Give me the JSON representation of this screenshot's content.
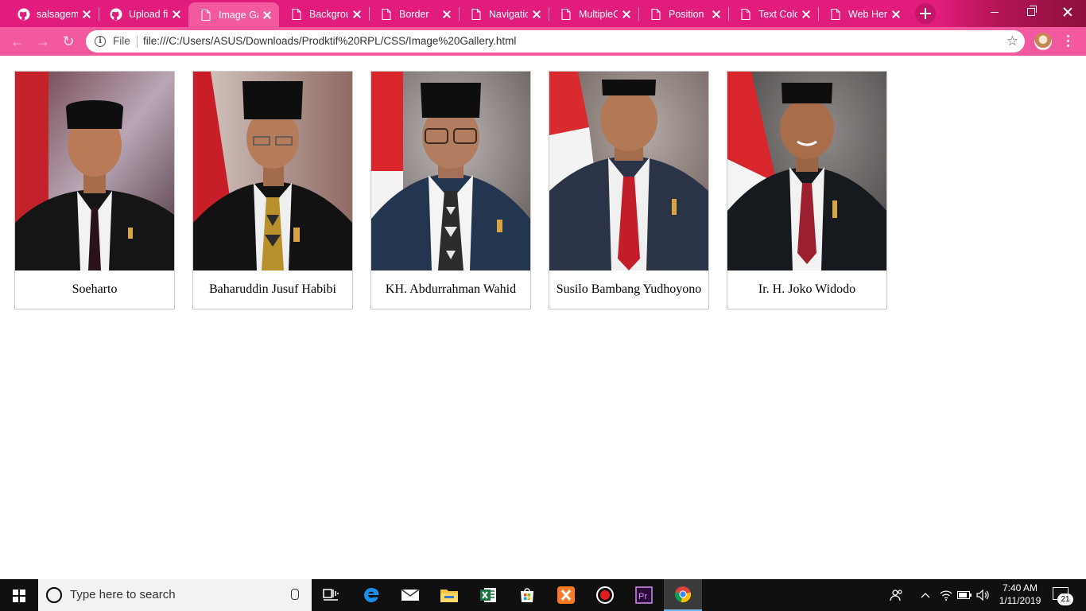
{
  "browser": {
    "tabs": [
      {
        "title": "salsagem",
        "icon": "github-icon",
        "active": false
      },
      {
        "title": "Upload fi",
        "icon": "github-icon",
        "active": false
      },
      {
        "title": "Image Ga",
        "icon": "page-icon",
        "active": true
      },
      {
        "title": "Backgrou",
        "icon": "page-icon",
        "active": false
      },
      {
        "title": "Border",
        "icon": "page-icon",
        "active": false
      },
      {
        "title": "Navigatic",
        "icon": "page-icon",
        "active": false
      },
      {
        "title": "MultipleC",
        "icon": "page-icon",
        "active": false
      },
      {
        "title": "Position I",
        "icon": "page-icon",
        "active": false
      },
      {
        "title": "Text Colo",
        "icon": "page-icon",
        "active": false
      },
      {
        "title": "Web Her",
        "icon": "page-icon",
        "active": false
      }
    ],
    "address": {
      "scheme_label": "File",
      "url": "file:///C:/Users/ASUS/Downloads/Prodktif%20RPL/CSS/Image%20Gallery.html"
    },
    "colors": {
      "tabstrip": "#e11c7c",
      "toolbar": "#f2599f"
    }
  },
  "gallery": [
    {
      "caption": "Soeharto",
      "photo": "portrait-soeharto"
    },
    {
      "caption": "Baharuddin Jusuf Habibi",
      "photo": "portrait-habibi"
    },
    {
      "caption": "KH. Abdurrahman Wahid",
      "photo": "portrait-wahid"
    },
    {
      "caption": "Susilo Bambang Yudhoyono",
      "photo": "portrait-yudhoyono"
    },
    {
      "caption": "Ir. H. Joko Widodo",
      "photo": "portrait-widodo"
    }
  ],
  "taskbar": {
    "search_placeholder": "Type here to search",
    "time": "7:40 AM",
    "date": "1/11/2019",
    "notification_count": "21",
    "apps": [
      "task-view-icon",
      "edge-icon",
      "mail-icon",
      "file-explorer-icon",
      "excel-icon",
      "store-icon",
      "xampp-icon",
      "recorder-icon",
      "premiere-icon",
      "chrome-icon"
    ]
  }
}
